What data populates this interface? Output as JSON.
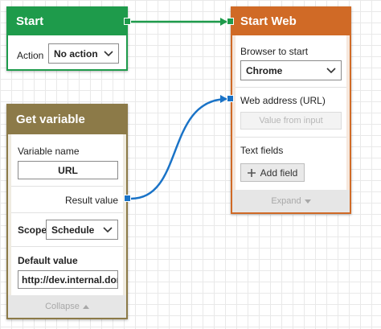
{
  "colors": {
    "start_header": "#1e9b4b",
    "browser_header": "#d06a26",
    "variable_header": "#8c7a48",
    "blue_connection": "#1a73c7",
    "green_connection": "#1e9b4b"
  },
  "start_node": {
    "title": "Start",
    "action_label": "Action",
    "action_value": "No action"
  },
  "browser_node": {
    "title": "Start Web Browser",
    "browser_label": "Browser to start",
    "browser_value": "Chrome",
    "web_address_label": "Web address (URL)",
    "value_from_input_button": "Value from input",
    "text_fields_label": "Text fields",
    "add_field_button": "Add field",
    "add_field_icon": "plus-icon",
    "expand_label": "Expand"
  },
  "variable_node": {
    "title": "Get variable",
    "variable_name_label": "Variable name",
    "variable_name_value": "URL",
    "result_value_label": "Result value",
    "scope_label": "Scope",
    "scope_value": "Schedule",
    "default_value_label": "Default value",
    "default_value_value": "http://dev.internal.dom",
    "collapse_label": "Collapse"
  }
}
